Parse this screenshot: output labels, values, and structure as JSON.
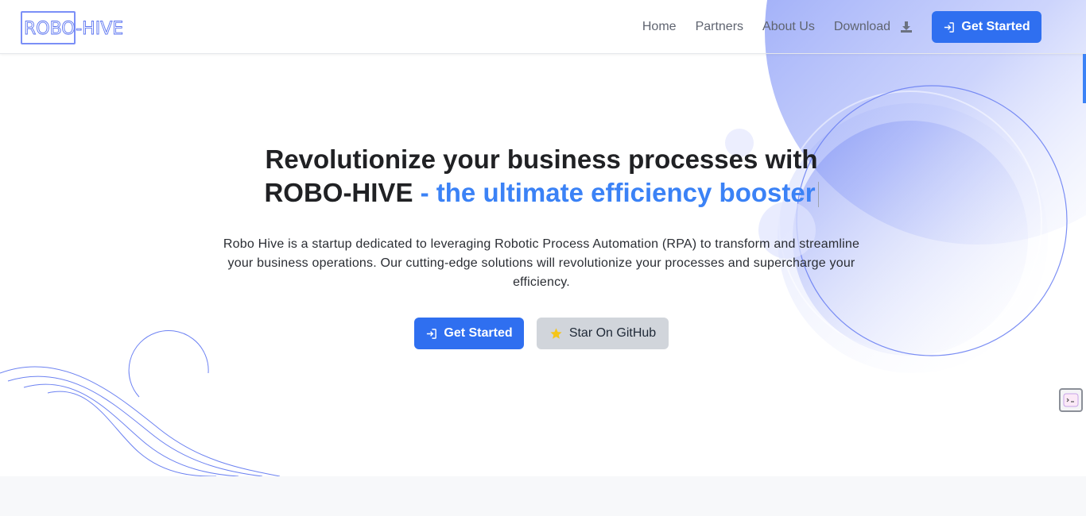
{
  "brand": {
    "logo_text": "ROBO-HIVE"
  },
  "nav": {
    "items": [
      {
        "label": "Home"
      },
      {
        "label": "Partners"
      },
      {
        "label": "About Us"
      },
      {
        "label": "Download"
      }
    ],
    "cta_label": "Get Started"
  },
  "hero": {
    "title_line1": "Revolutionize your business processes with",
    "title_brand": "ROBO-HIVE",
    "title_accent": "- the ultimate efficiency booster",
    "description": "Robo Hive is a startup dedicated to leveraging Robotic Process Automation (RPA) to transform and streamline your business operations. Our cutting-edge solutions will revolutionize your processes and supercharge your efficiency.",
    "primary_cta": "Get Started",
    "secondary_cta": "Star On GitHub"
  },
  "icons": {
    "download": "download-icon",
    "login": "sign-in-icon",
    "star": "star-icon",
    "widget": "chat-widget-icon"
  },
  "colors": {
    "accent": "#3b82f6",
    "button": "#2f6ff0",
    "secondary_button": "#d1d5db",
    "star": "#f5c518"
  }
}
